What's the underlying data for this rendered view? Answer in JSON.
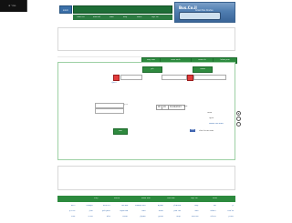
{
  "corner_badge": "הגדר זה",
  "header": {
    "logo_text": "Bus.Co.il",
    "logo_sub": "Israeli Bus Routes",
    "search_label": "חיפוש",
    "search_placeholder": "",
    "nav": [
      "בית הספר",
      "לוח זמנים",
      "מפות",
      "קווים",
      "תחנות",
      "צור קשר"
    ]
  },
  "planner": {
    "title": "תכנון מסלול",
    "title_link": "חדש",
    "tabs": [
      "תכנון מסלול",
      "לוח זמנים",
      "לוחות זמנים",
      "מפת קווים",
      "תחנות"
    ],
    "from_label": "מאיפה",
    "from_value": "",
    "to_label": "לאן",
    "to_value": "",
    "via_label": "דרך",
    "swap_link": "החלף",
    "time_label": "שעה",
    "date_value": "15/12/2013",
    "hour_value": "20",
    "min_value": "00",
    "depart_label": "יציאה",
    "arrive_label": "הגעה",
    "search_button": "חפש",
    "options_link": "אפשרויות נוספות",
    "like_label": "Like",
    "like_count": "0",
    "share_text": "מפת ישראל שלנו"
  },
  "footer": {
    "top_links": [
      "אודות",
      "צור קשר",
      "מפת אתר",
      "תנאי שימוש",
      "פרטיות",
      "עזרה"
    ],
    "columns": [
      [
        "דן",
        "אגד",
        "קווים",
        "מטרופולין",
        "אפיקים",
        "נתיב אקספרס",
        "סופרבוס",
        "גי.בי.טורס",
        "אקסטרה",
        "רכבת"
      ],
      [
        "תל אביב",
        "ירושלים",
        "חיפה",
        "באר שבע",
        "אשדוד",
        "נתניה",
        "פתח תקווה",
        "ראשון לציון",
        "חולון",
        "בני ברק"
      ],
      [
        "רמת גן",
        "הרצליה",
        "כפר סבא",
        "רעננה",
        "מודיעין",
        "אשקלון",
        "רחובות",
        "אילת",
        "טבריה",
        "נצרת"
      ]
    ]
  }
}
